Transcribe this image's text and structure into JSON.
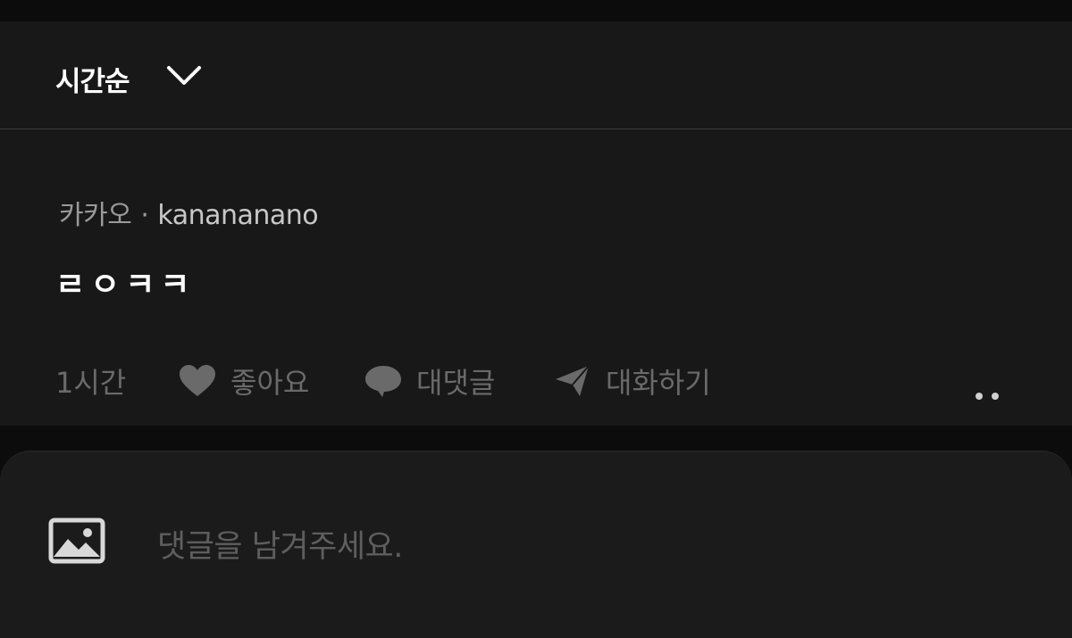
{
  "sort": {
    "label": "시간순",
    "icon": "chevron-down-icon"
  },
  "comment": {
    "provider": "카카오",
    "separator": "·",
    "username": "kanananano",
    "text": "ㄹㅇㅋㅋ",
    "time": "1시간",
    "actions": {
      "like_label": "좋아요",
      "reply_label": "대댓글",
      "chat_label": "대화하기"
    }
  },
  "composer": {
    "placeholder": "댓글을 남겨주세요.",
    "image_icon": "image-icon"
  },
  "colors": {
    "panel": "#181818",
    "background": "#0c0c0c",
    "muted": "#6a6a6a",
    "text": "#ffffff"
  }
}
